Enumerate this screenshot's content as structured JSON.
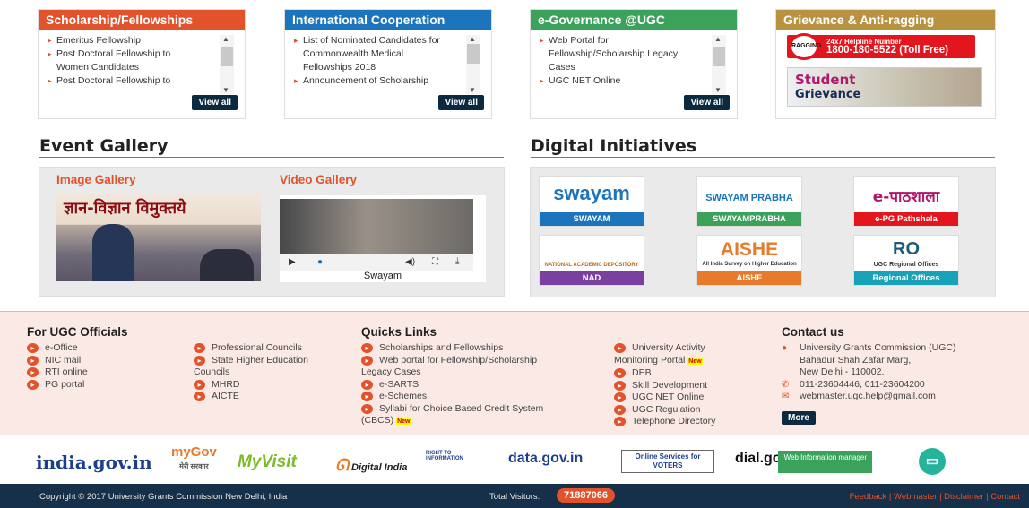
{
  "boxes": {
    "scholarship": {
      "title": "Scholarship/Fellowships",
      "color": "#e2522b",
      "items": [
        "Emeritus Fellowship",
        "Post Doctoral Fellowship to",
        "Women Candidates",
        "Post Doctoral Fellowship to"
      ],
      "view_all": "View all"
    },
    "international": {
      "title": "International Cooperation",
      "color": "#1c75bc",
      "items": [
        "List of Nominated Candidates for",
        "Commonwealth Medical",
        "Fellowships 2018",
        "Announcement of Scholarship"
      ],
      "view_all": "View all"
    },
    "egov": {
      "title": "e-Governance @UGC",
      "color": "#3aa25a",
      "items": [
        "Web Portal for",
        "Fellowship/Scholarship Legacy",
        "Cases",
        "UGC NET Online"
      ],
      "view_all": "View all"
    },
    "grievance": {
      "title": "Grievance & Anti-ragging",
      "color": "#b8923f",
      "ragging_badge": "RAGGING",
      "helpline_label": "24x7 Helpline Number",
      "helpline_number": "1800-180-5522 (Toll Free)",
      "student_label": "Student",
      "grievance_label": "Grievance"
    }
  },
  "event_gallery": {
    "title": "Event Gallery",
    "image_label": "Image Gallery",
    "video_label": "Video Gallery",
    "image_caption_hindi": "ज्ञान-विज्ञान विमुक्तये",
    "video_caption": "Swayam"
  },
  "digital": {
    "title": "Digital Initiatives",
    "tiles": [
      {
        "logo": "swayam",
        "label": "SWAYAM",
        "color": "#1c75bc"
      },
      {
        "logo": "SWAYAM PRABHA",
        "label": "SWAYAMPRABHA",
        "color": "#3aa25a"
      },
      {
        "logo": "e-पाठशाला",
        "label": "e-PG Pathshala",
        "color": "#e3161e"
      },
      {
        "logo": "NATIONAL ACADEMIC DEPOSITORY",
        "label": "NAD",
        "color": "#7b3fa0"
      },
      {
        "logo": "AISHE",
        "label": "AISHE",
        "color": "#e87a2b"
      },
      {
        "logo": "RO",
        "label": "Regional Offices",
        "color": "#17a2b8"
      }
    ],
    "aishe_sub": "All India Survey on Higher Education",
    "ro_sub": "UGC Regional Offices"
  },
  "footer": {
    "officials": {
      "title": "For UGC Officials",
      "col1": [
        "e-Office",
        "NIC mail",
        "RTI online",
        "PG portal"
      ],
      "col2": [
        "Professional Councils",
        "State Higher Education",
        "Councils",
        "MHRD",
        "AICTE"
      ]
    },
    "quick": {
      "title": "Quicks Links",
      "col1": [
        "Scholarships and Fellowships",
        "Web portal for Fellowship/Scholarship",
        "Legacy Cases",
        "e-SARTS",
        "e-Schemes",
        "Syllabi for Choice Based Credit System",
        "(CBCS)"
      ],
      "col2": [
        "University Activity",
        "Monitoring Portal",
        "DEB",
        "Skill Development",
        "UGC NET Online",
        "UGC Regulation",
        "Telephone Directory"
      ],
      "new_badge": "New"
    },
    "contact": {
      "title": "Contact us",
      "address": [
        "University Grants Commission (UGC)",
        "Bahadur Shah Zafar Marg,",
        "New Delhi - 110002."
      ],
      "phone": "011-23604446, 011-23604200",
      "email": "webmaster.ugc.help@gmail.com",
      "more": "More"
    }
  },
  "logos": [
    "india.gov.in",
    "myGov",
    "MyVisit",
    "Digital India",
    "RIGHT TO INFORMATION",
    "data.gov.in",
    "Online Services for VOTERS",
    "dial.gov",
    "Web Information manager"
  ],
  "mygov_hindi": "मेरी सरकार",
  "copyright": {
    "text": "Copyright © 2017 University Grants Commission New Delhi, India",
    "visitors_label": "Total Visitors:",
    "visitors": "71887066",
    "links": "Feedback | Webmaster | Disclaimer | Contact"
  }
}
